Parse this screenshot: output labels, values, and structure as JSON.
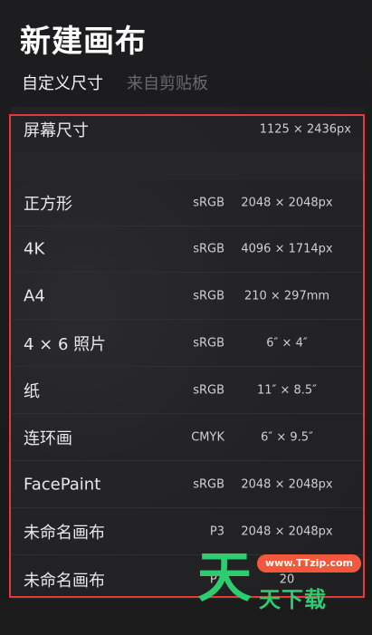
{
  "header": {
    "title": "新建画布"
  },
  "tabs": [
    {
      "label": "自定义尺寸",
      "active": true
    },
    {
      "label": "来自剪贴板",
      "active": false
    }
  ],
  "screen_size": {
    "label": "屏幕尺寸",
    "dimensions": "1125 × 2436px"
  },
  "presets": [
    {
      "name": "正方形",
      "color_space": "sRGB",
      "dimensions": "2048 × 2048px"
    },
    {
      "name": "4K",
      "color_space": "sRGB",
      "dimensions": "4096 × 1714px"
    },
    {
      "name": "A4",
      "color_space": "sRGB",
      "dimensions": "210 × 297mm"
    },
    {
      "name": "4 × 6 照片",
      "color_space": "sRGB",
      "dimensions": "6″ × 4″"
    },
    {
      "name": "纸",
      "color_space": "sRGB",
      "dimensions": "11″ × 8.5″"
    },
    {
      "name": "连环画",
      "color_space": "CMYK",
      "dimensions": "6″ × 9.5″"
    },
    {
      "name": "FacePaint",
      "color_space": "sRGB",
      "dimensions": "2048 × 2048px"
    },
    {
      "name": "未命名画布",
      "color_space": "P3",
      "dimensions": "2048 × 2048px"
    },
    {
      "name": "未命名画布",
      "color_space": "P3",
      "dimensions": "20"
    }
  ],
  "watermark": {
    "big_char": "天",
    "url": "www.TTzip.com",
    "text": "天下载"
  },
  "colors": {
    "highlight_border": "#e23a3a",
    "watermark_green": "#2ecc71",
    "watermark_orange": "#f1583c"
  }
}
